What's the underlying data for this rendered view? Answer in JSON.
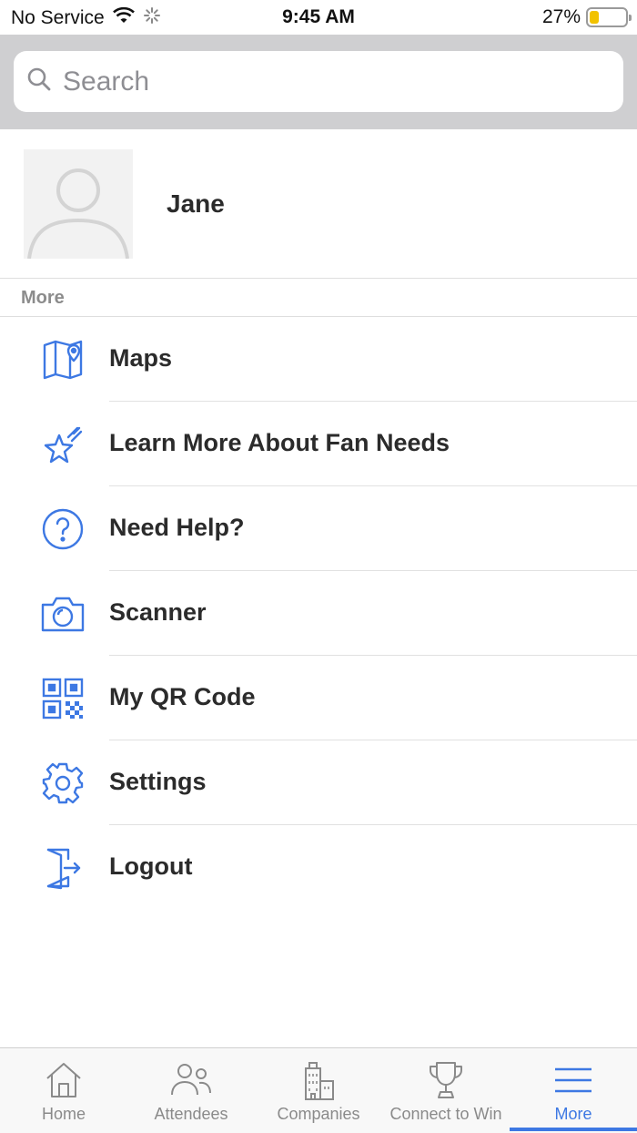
{
  "status_bar": {
    "carrier": "No Service",
    "time": "9:45 AM",
    "battery_percent_text": "27%",
    "battery_level": 0.27
  },
  "search": {
    "placeholder": "Search",
    "value": ""
  },
  "profile": {
    "name": "Jane"
  },
  "section": {
    "title": "More"
  },
  "menu": {
    "items": [
      {
        "label": "Maps",
        "icon": "map-icon"
      },
      {
        "label": "Learn More About Fan Needs",
        "icon": "star-icon"
      },
      {
        "label": "Need Help?",
        "icon": "help-icon"
      },
      {
        "label": "Scanner",
        "icon": "camera-icon"
      },
      {
        "label": "My QR Code",
        "icon": "qr-code-icon"
      },
      {
        "label": "Settings",
        "icon": "gear-icon"
      },
      {
        "label": "Logout",
        "icon": "logout-icon"
      }
    ]
  },
  "tab_bar": {
    "tabs": [
      {
        "label": "Home",
        "icon": "home-icon"
      },
      {
        "label": "Attendees",
        "icon": "people-icon"
      },
      {
        "label": "Companies",
        "icon": "building-icon"
      },
      {
        "label": "Connect to Win",
        "icon": "trophy-icon"
      },
      {
        "label": "More",
        "icon": "menu-icon",
        "active": true
      }
    ]
  },
  "colors": {
    "accent": "#3d78e3",
    "battery": "#f2c200",
    "search_band": "#cfcfd1"
  }
}
